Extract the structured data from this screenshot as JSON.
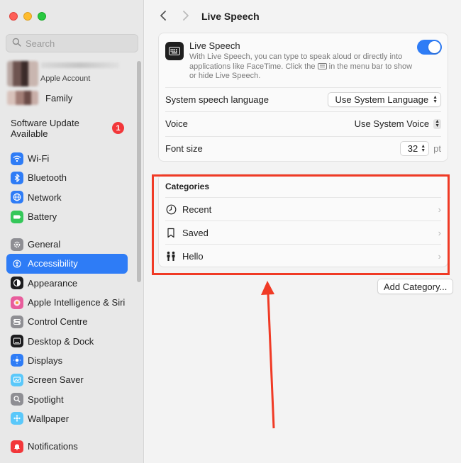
{
  "window": {
    "traffic_lights": [
      "close",
      "minimize",
      "zoom"
    ]
  },
  "sidebar": {
    "search": {
      "placeholder": "Search"
    },
    "account": {
      "label": "Apple Account"
    },
    "family": {
      "label": "Family"
    },
    "software_update": {
      "label": "Software Update Available",
      "badge": "1"
    },
    "groups": [
      [
        {
          "label": "Wi-Fi",
          "icon": "wifi-icon",
          "color": "#2e7cf6"
        },
        {
          "label": "Bluetooth",
          "icon": "bluetooth-icon",
          "color": "#2e7cf6"
        },
        {
          "label": "Network",
          "icon": "globe-icon",
          "color": "#2e7cf6"
        },
        {
          "label": "Battery",
          "icon": "battery-icon",
          "color": "#34c759"
        }
      ],
      [
        {
          "label": "General",
          "icon": "gear-icon",
          "color": "#8e8e93"
        },
        {
          "label": "Accessibility",
          "icon": "accessibility-icon",
          "color": "#2e7cf6",
          "active": true
        },
        {
          "label": "Appearance",
          "icon": "appearance-icon",
          "color": "#1c1c1e"
        },
        {
          "label": "Apple Intelligence & Siri",
          "icon": "siri-icon",
          "color": "#e85d9c"
        },
        {
          "label": "Control Centre",
          "icon": "control-centre-icon",
          "color": "#8e8e93"
        },
        {
          "label": "Desktop & Dock",
          "icon": "dock-icon",
          "color": "#1c1c1e"
        },
        {
          "label": "Displays",
          "icon": "displays-icon",
          "color": "#2e7cf6"
        },
        {
          "label": "Screen Saver",
          "icon": "screen-saver-icon",
          "color": "#5ac8fa"
        },
        {
          "label": "Spotlight",
          "icon": "spotlight-icon",
          "color": "#8e8e93"
        },
        {
          "label": "Wallpaper",
          "icon": "wallpaper-icon",
          "color": "#5ac8fa"
        }
      ],
      [
        {
          "label": "Notifications",
          "icon": "notifications-icon",
          "color": "#f2373a"
        }
      ]
    ]
  },
  "main": {
    "title": "Live Speech",
    "live_speech": {
      "title": "Live Speech",
      "description_before_icon": "With Live Speech, you can type to speak aloud or directly into applications like FaceTime. Click the",
      "description_after_icon": "in the menu bar to show or hide Live Speech.",
      "enabled": true
    },
    "settings": [
      {
        "label": "System speech language",
        "value": "Use System Language"
      },
      {
        "label": "Voice",
        "value": "Use System Voice"
      },
      {
        "label": "Font size",
        "value": "32",
        "unit": "pt"
      }
    ],
    "categories": {
      "heading": "Categories",
      "items": [
        {
          "label": "Recent",
          "icon": "clock-icon"
        },
        {
          "label": "Saved",
          "icon": "bookmark-icon"
        },
        {
          "label": "Hello",
          "icon": "people-icon"
        }
      ]
    },
    "add_category_label": "Add Category..."
  },
  "annotation": {
    "color": "#f03a25"
  }
}
